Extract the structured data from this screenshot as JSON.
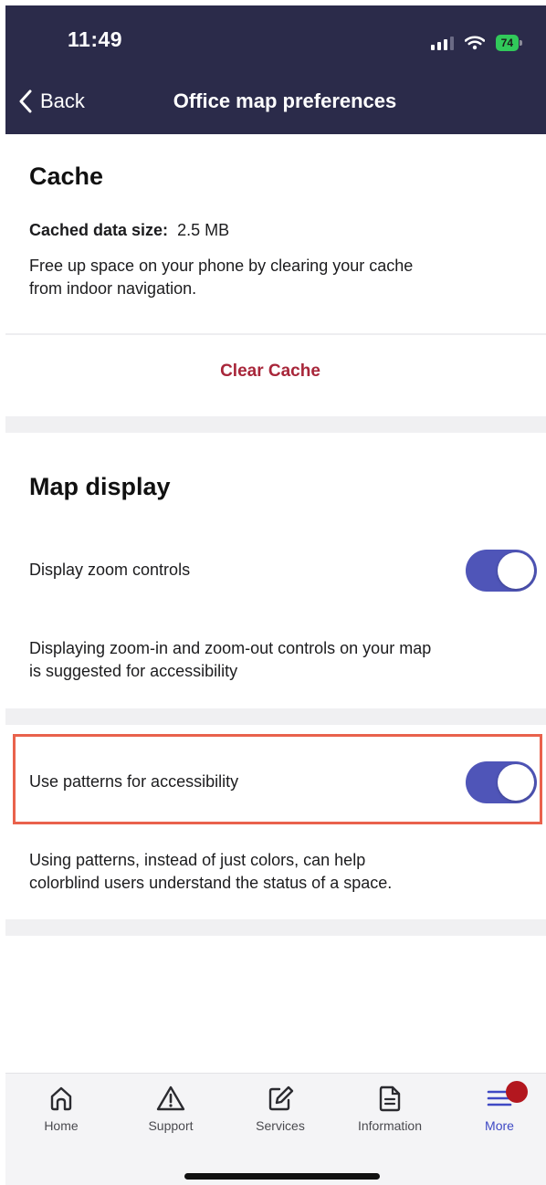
{
  "status_bar": {
    "time": "11:49",
    "battery": "74",
    "icons": [
      "signal-icon",
      "wifi-icon",
      "battery-icon"
    ]
  },
  "nav": {
    "back_label": "Back",
    "back_icon": "chevron-left-icon",
    "title": "Office map preferences"
  },
  "cache": {
    "title": "Cache",
    "size_label": "Cached data size:",
    "size_value": "2.5 MB",
    "description_line1": "Free up space on your phone by clearing your cache",
    "description_line2": "from indoor navigation.",
    "clear_button": "Clear Cache"
  },
  "map_display": {
    "title": "Map display",
    "zoom_label": "Display zoom controls",
    "zoom_enabled": true,
    "zoom_description_line1": "Displaying zoom-in and zoom-out controls on your map",
    "zoom_description_line2": "is suggested for accessibility",
    "patterns_label": "Use patterns for accessibility",
    "patterns_enabled": true,
    "patterns_description_line1": "Using patterns, instead of just colors, can help",
    "patterns_description_line2": "colorblind users understand the status of a space."
  },
  "tabs": [
    {
      "label": "Home",
      "icon": "home-icon"
    },
    {
      "label": "Support",
      "icon": "warning-icon"
    },
    {
      "label": "Services",
      "icon": "edit-icon"
    },
    {
      "label": "Information",
      "icon": "document-icon"
    },
    {
      "label": "More",
      "icon": "menu-icon",
      "active": true,
      "badge": true
    }
  ],
  "colors": {
    "header_bg": "#2b2b4a",
    "accent": "#4f55b8",
    "destructive": "#a8263a",
    "highlight": "#e9624c",
    "badge": "#b3171f"
  }
}
